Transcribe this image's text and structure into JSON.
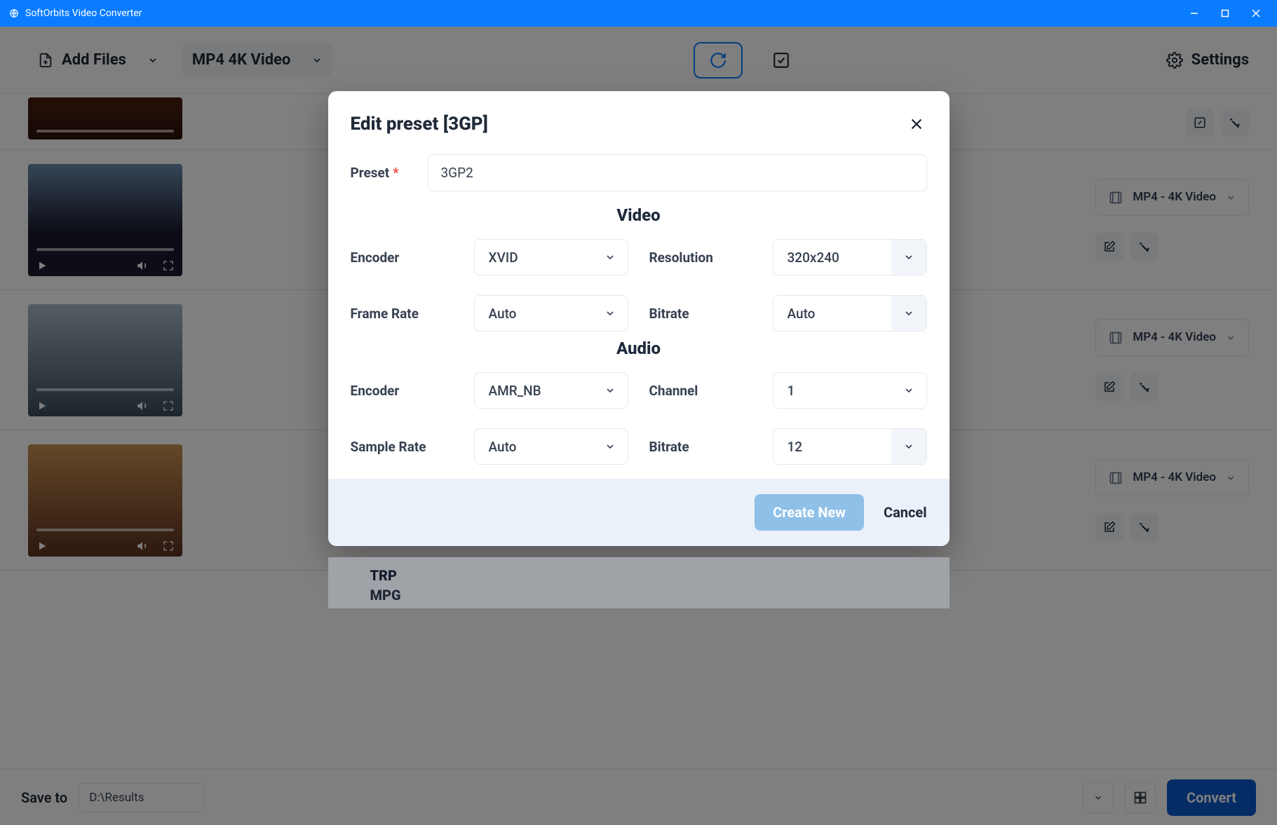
{
  "titlebar": {
    "title": "SoftOrbits Video Converter"
  },
  "toolbar": {
    "add_files": "Add Files",
    "format_preset": "MP4 4K Video",
    "settings": "Settings"
  },
  "footer": {
    "save_to_label": "Save to",
    "save_to_path": "D:\\Results",
    "convert": "Convert"
  },
  "file_format_label": "MP4 - 4K Video",
  "dropdown_items": [
    "TRP",
    "MPG"
  ],
  "modal": {
    "title": "Edit preset [3GP]",
    "preset_label": "Preset",
    "preset_value": "3GP2",
    "video_section": "Video",
    "audio_section": "Audio",
    "video": {
      "encoder_label": "Encoder",
      "encoder_value": "XVID",
      "resolution_label": "Resolution",
      "resolution_value": "320x240",
      "framerate_label": "Frame Rate",
      "framerate_value": "Auto",
      "bitrate_label": "Bitrate",
      "bitrate_value": "Auto"
    },
    "audio": {
      "encoder_label": "Encoder",
      "encoder_value": "AMR_NB",
      "channel_label": "Channel",
      "channel_value": "1",
      "samplerate_label": "Sample Rate",
      "samplerate_value": "Auto",
      "bitrate_label": "Bitrate",
      "bitrate_value": "12"
    },
    "create_new": "Create New",
    "cancel": "Cancel"
  }
}
